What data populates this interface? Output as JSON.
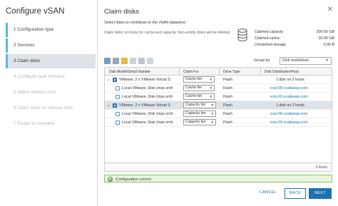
{
  "wizard": {
    "title": "Configure vSAN",
    "steps": [
      {
        "label": "1  Configuration type",
        "state": "done"
      },
      {
        "label": "2  Services",
        "state": "done"
      },
      {
        "label": "3  Claim disks",
        "state": "active"
      },
      {
        "label": "4  Configure fault domains",
        "state": "future"
      },
      {
        "label": "5  Select witness host",
        "state": "future"
      },
      {
        "label": "6  Claim disks for witness host",
        "state": "future"
      },
      {
        "label": "7  Ready to complete",
        "state": "future"
      }
    ]
  },
  "main": {
    "heading": "Claim disks",
    "close_icon": "close-icon",
    "subtitle": "Select disks to contribute to the vSAN datastore.",
    "description": "Claim disks on hosts for cache and capacity. Non-empty disks will be deleted.",
    "stats": [
      {
        "label": "Claimed capacity",
        "value": "200.00 GB"
      },
      {
        "label": "Claimed cache",
        "value": "20.00 GB"
      },
      {
        "label": "Unclaimed storage",
        "value": "0.00 B"
      }
    ]
  },
  "toolbar": {
    "icons": [
      "claim-cache-icon",
      "claim-capacity-icon",
      "mark-flash-icon",
      "mark-hdd-icon",
      "mark-local-icon",
      "grid-view-icon"
    ],
    "group_by_label": "Group by:",
    "group_by_value": "Disk model/size"
  },
  "table": {
    "headers": [
      "Disk Model/Serial Number",
      "Claim For",
      "Drive Type",
      "Disk Distribution/Host"
    ],
    "rows": [
      {
        "kind": "group",
        "name": "VMware, 2 x VMware Virtual S",
        "claim": "Cache tier",
        "drive": "Flash",
        "dist": "1 disk on 2 hosts",
        "selected": false
      },
      {
        "kind": "disk",
        "name": "Local VMware, Disk (mpx.vmh",
        "claim": "Cache tier",
        "drive": "Flash",
        "dist": "esxi-08.vcallaway.com"
      },
      {
        "kind": "disk",
        "name": "Local VMware, Disk (mpx.vmh",
        "claim": "Cache tier",
        "drive": "Flash",
        "dist": "esxi-09.vcallaway.com"
      },
      {
        "kind": "group",
        "name": "VMware, 2 x VMware Virtual S",
        "claim": "Capacity tier",
        "drive": "Flash",
        "dist": "1 disk on 2 hosts",
        "selected": true
      },
      {
        "kind": "disk",
        "name": "Local VMware, Disk (mpx.vmh",
        "claim": "Capacity tier",
        "drive": "Flash",
        "dist": "esxi-08.vcallaway.com"
      },
      {
        "kind": "disk",
        "name": "Local VMware, Disk (mpx.vmh",
        "claim": "Capacity tier",
        "drive": "Flash",
        "dist": "esxi-09.vcallaway.com"
      }
    ],
    "footer": "6 items"
  },
  "alert": {
    "text": "Configuration correct",
    "color": "#87c55e"
  },
  "buttons": {
    "cancel": "CANCEL",
    "back": "BACK",
    "next": "NEXT"
  },
  "colors": {
    "accent": "#1a73b0",
    "step_marker": "#5bb6e3",
    "selected_bg": "#dde3e8"
  }
}
